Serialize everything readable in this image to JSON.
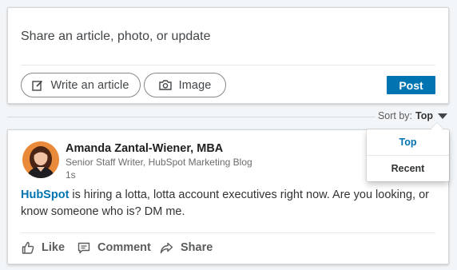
{
  "share": {
    "prompt": "Share an article, photo, or update",
    "write_article_label": "Write an article",
    "write_article_icon": "compose-icon",
    "image_label": "Image",
    "image_icon": "camera-icon",
    "post_label": "Post"
  },
  "sort": {
    "label": "Sort by:",
    "value": "Top",
    "options": [
      "Top",
      "Recent"
    ]
  },
  "post": {
    "author_name": "Amanda Zantal-Wiener, MBA",
    "author_headline": "Senior Staff Writer, HubSpot Marketing Blog",
    "time": "1s",
    "mention": "HubSpot",
    "body_rest": " is hiring a lotta, lotta account executives right now. Are you looking, or know someone who is? DM me.",
    "actions": {
      "like": "Like",
      "comment": "Comment",
      "share": "Share"
    }
  },
  "colors": {
    "accent": "#0073b1",
    "background": "#f3f6f8"
  }
}
